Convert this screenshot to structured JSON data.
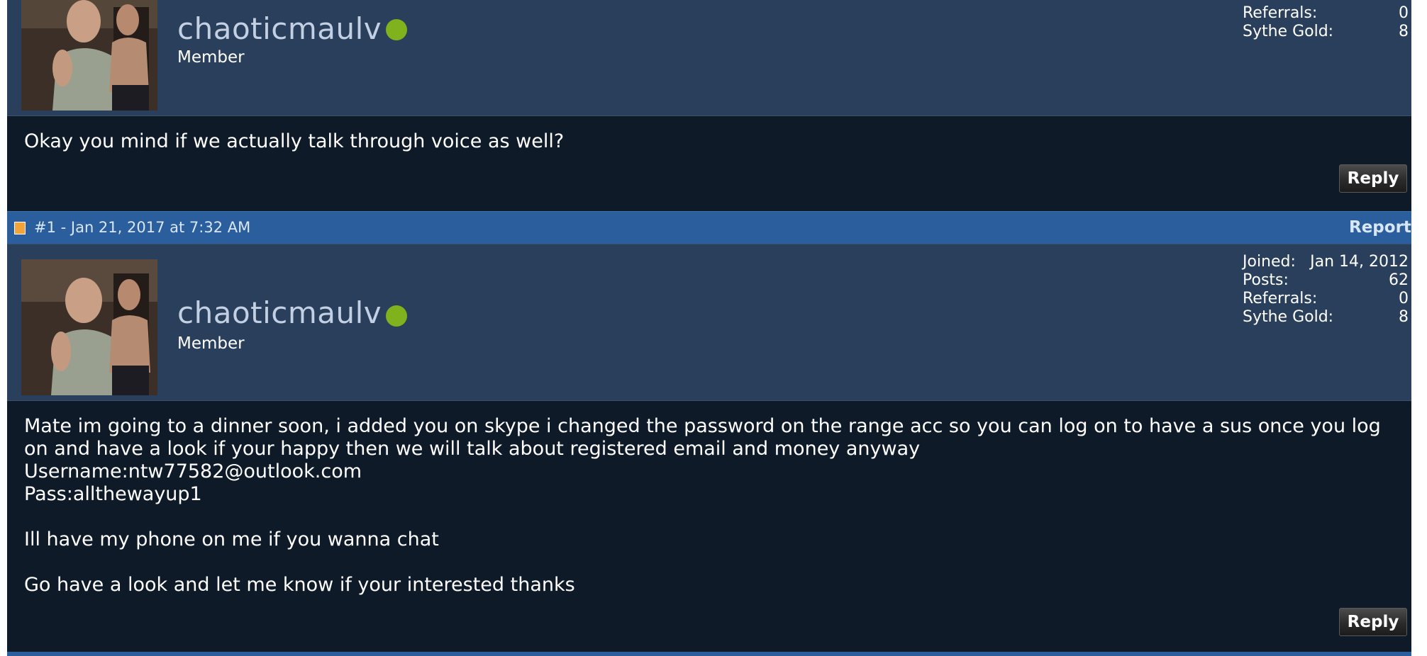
{
  "posts": [
    {
      "username": "chaoticmaulv",
      "rank": "Member",
      "stats": [
        {
          "label": "Referrals:",
          "value": "0"
        },
        {
          "label": "Sythe Gold:",
          "value": "8"
        }
      ],
      "message": "Okay you mind if we actually talk through voice as well?",
      "reply_label": "Reply"
    },
    {
      "post_meta": "#1 - Jan 21, 2017 at 7:32 AM",
      "report_label": "Report",
      "username": "chaoticmaulv",
      "rank": "Member",
      "stats": [
        {
          "label": "Joined:",
          "value": "Jan 14, 2012"
        },
        {
          "label": "Posts:",
          "value": "62"
        },
        {
          "label": "Referrals:",
          "value": "0"
        },
        {
          "label": "Sythe Gold:",
          "value": "8"
        }
      ],
      "message": "Mate im going to a dinner soon, i added you on skype i changed the password on the range acc so you can log on to have a sus once you log on and have a look if your happy then we will talk about registered email and money anyway\nUsername:ntw77582@outlook.com\nPass:allthewayup1\n\nIll have my phone on me if you wanna chat\n\nGo have a look and let me know if your interested thanks",
      "reply_label": "Reply"
    }
  ],
  "colors": {
    "background": "#0f1a28",
    "userbar": "#2a3f5c",
    "postbar": "#2b5e9c",
    "online": "#7fb21c"
  }
}
